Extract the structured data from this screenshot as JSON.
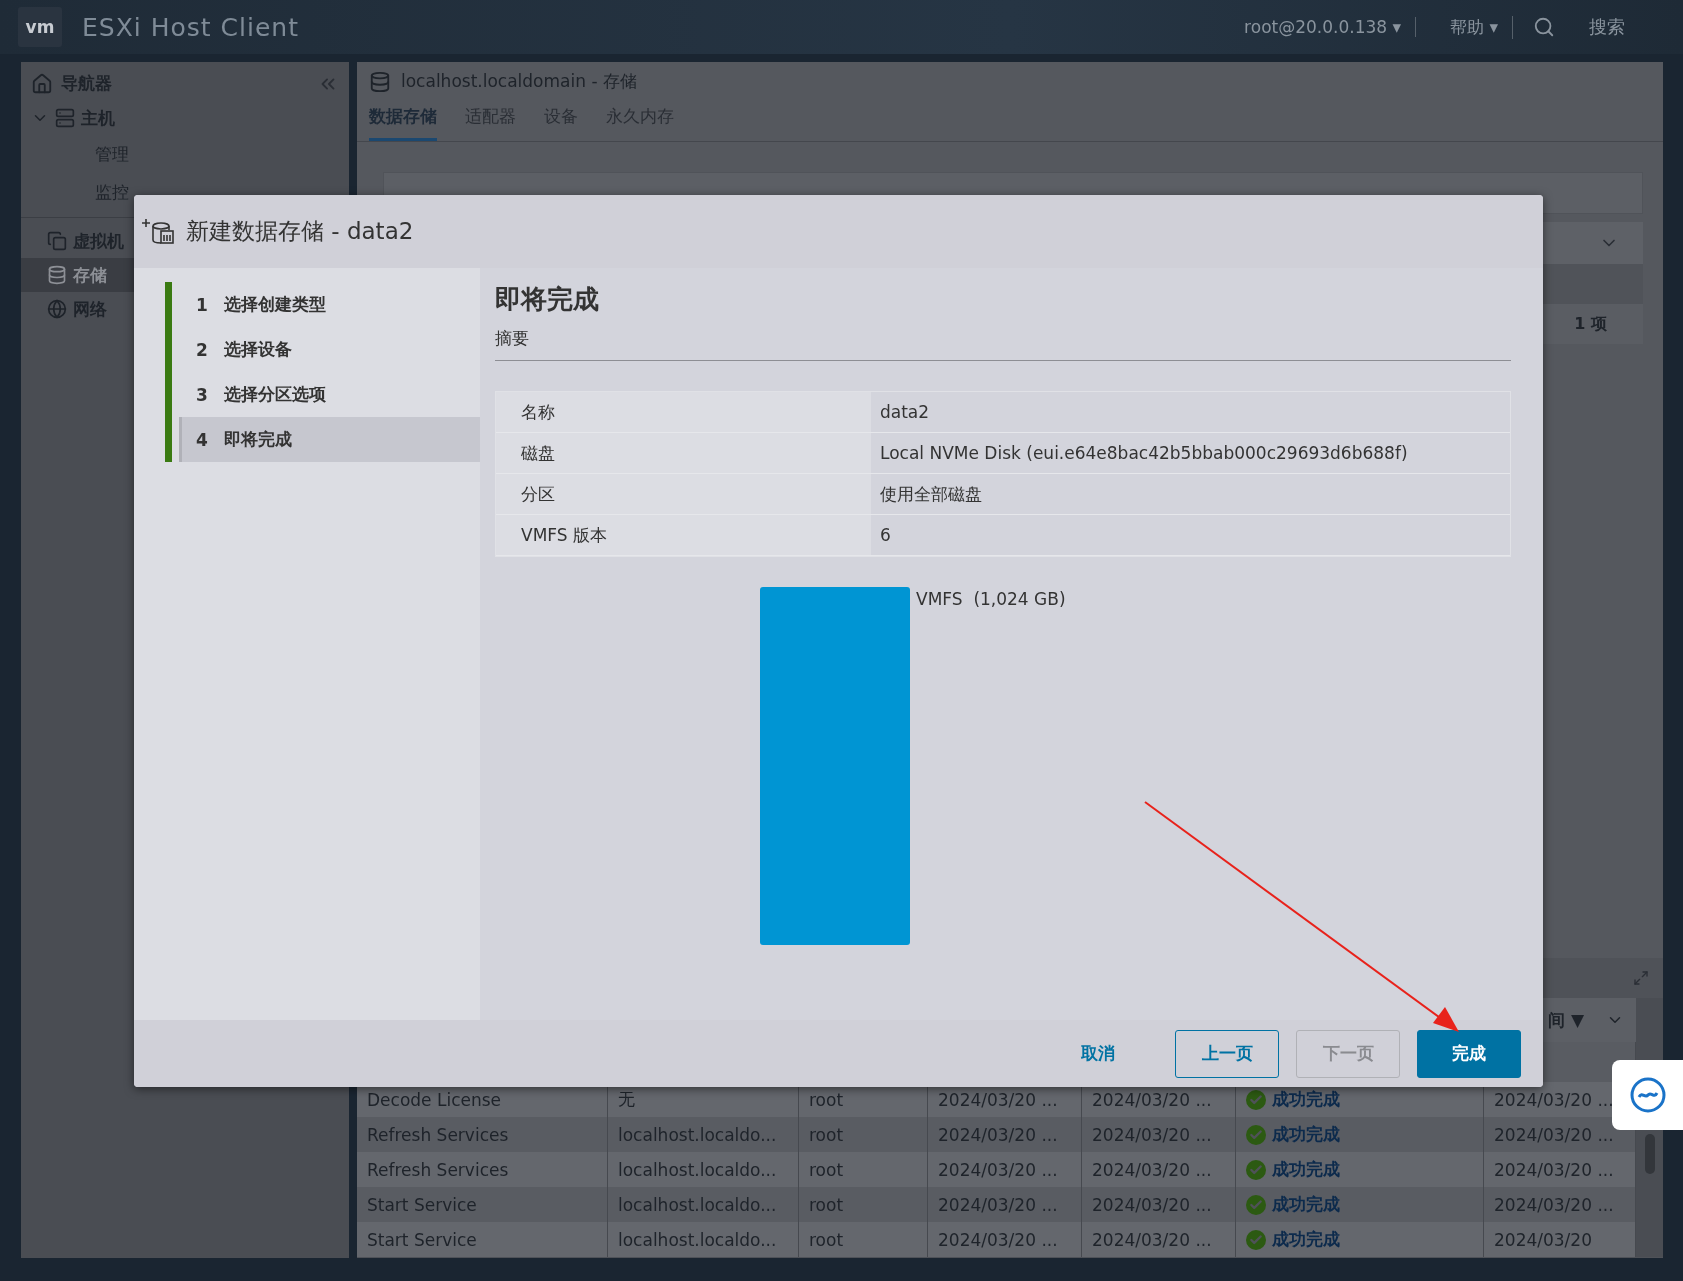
{
  "top_bar": {
    "logo": "vm",
    "product": "ESXi Host Client",
    "user_menu": "root@20.0.0.138 ▾",
    "help_menu": "帮助 ▾",
    "search": "搜索"
  },
  "navigator": {
    "title": "导航器",
    "items": [
      {
        "label": "主机",
        "selected": false,
        "expanded": true,
        "children": [
          {
            "label": "管理",
            "selected": false
          },
          {
            "label": "监控",
            "selected": false
          }
        ]
      },
      {
        "label": "虚拟机",
        "selected": false
      },
      {
        "label": "存储",
        "selected": true
      },
      {
        "label": "网络",
        "selected": false
      }
    ]
  },
  "main": {
    "title": "localhost.localdomain - 存储",
    "tabs": [
      {
        "label": "数据存储",
        "selected": true
      },
      {
        "label": "适配器",
        "selected": false
      },
      {
        "label": "设备",
        "selected": false
      },
      {
        "label": "永久内存",
        "selected": false
      }
    ],
    "datastores": {
      "count": "1 项"
    },
    "recent_tasks": {
      "column_7_header": "间 ▼",
      "rows": [
        {
          "task": "Decode License",
          "target": "无",
          "initiator": "root",
          "queued": "2024/03/20 ...",
          "started": "2024/03/20 ...",
          "result": "成功完成",
          "completed": "2024/03/20 ..."
        },
        {
          "task": "Refresh Services",
          "target": "localhost.localdo...",
          "initiator": "root",
          "queued": "2024/03/20 ...",
          "started": "2024/03/20 ...",
          "result": "成功完成",
          "completed": "2024/03/20 ..."
        },
        {
          "task": "Refresh Services",
          "target": "localhost.localdo...",
          "initiator": "root",
          "queued": "2024/03/20 ...",
          "started": "2024/03/20 ...",
          "result": "成功完成",
          "completed": "2024/03/20 ..."
        },
        {
          "task": "Start Service",
          "target": "localhost.localdo...",
          "initiator": "root",
          "queued": "2024/03/20 ...",
          "started": "2024/03/20 ...",
          "result": "成功完成",
          "completed": "2024/03/20 ..."
        },
        {
          "task": "Start Service",
          "target": "localhost.localdo...",
          "initiator": "root",
          "queued": "2024/03/20 ...",
          "started": "2024/03/20 ...",
          "result": "成功完成",
          "completed": "2024/03/20"
        }
      ]
    }
  },
  "dialog": {
    "title": "新建数据存储 - data2",
    "steps": [
      {
        "number": "1",
        "label": "选择创建类型",
        "selected": false
      },
      {
        "number": "2",
        "label": "选择设备",
        "selected": false
      },
      {
        "number": "3",
        "label": "选择分区选项",
        "selected": false
      },
      {
        "number": "4",
        "label": "即将完成",
        "selected": true
      }
    ],
    "heading": "即将完成",
    "subheading": "摘要",
    "summary": [
      {
        "key": "名称",
        "value": "data2"
      },
      {
        "key": "磁盘",
        "value": "Local NVMe Disk (eui.e64e8bac42b5bbab000c29693d6b688f)"
      },
      {
        "key": "分区",
        "value": "使用全部磁盘"
      },
      {
        "key": "VMFS 版本",
        "value": "6"
      }
    ],
    "partition": {
      "label": "VMFS",
      "size": "(1,024 GB)"
    },
    "buttons": [
      {
        "label": "取消",
        "kind": "link",
        "disabled": false
      },
      {
        "label": "上一页",
        "kind": "outline",
        "disabled": false
      },
      {
        "label": "下一页",
        "kind": "outline",
        "disabled": true
      },
      {
        "label": "完成",
        "kind": "primary",
        "disabled": false
      }
    ]
  }
}
